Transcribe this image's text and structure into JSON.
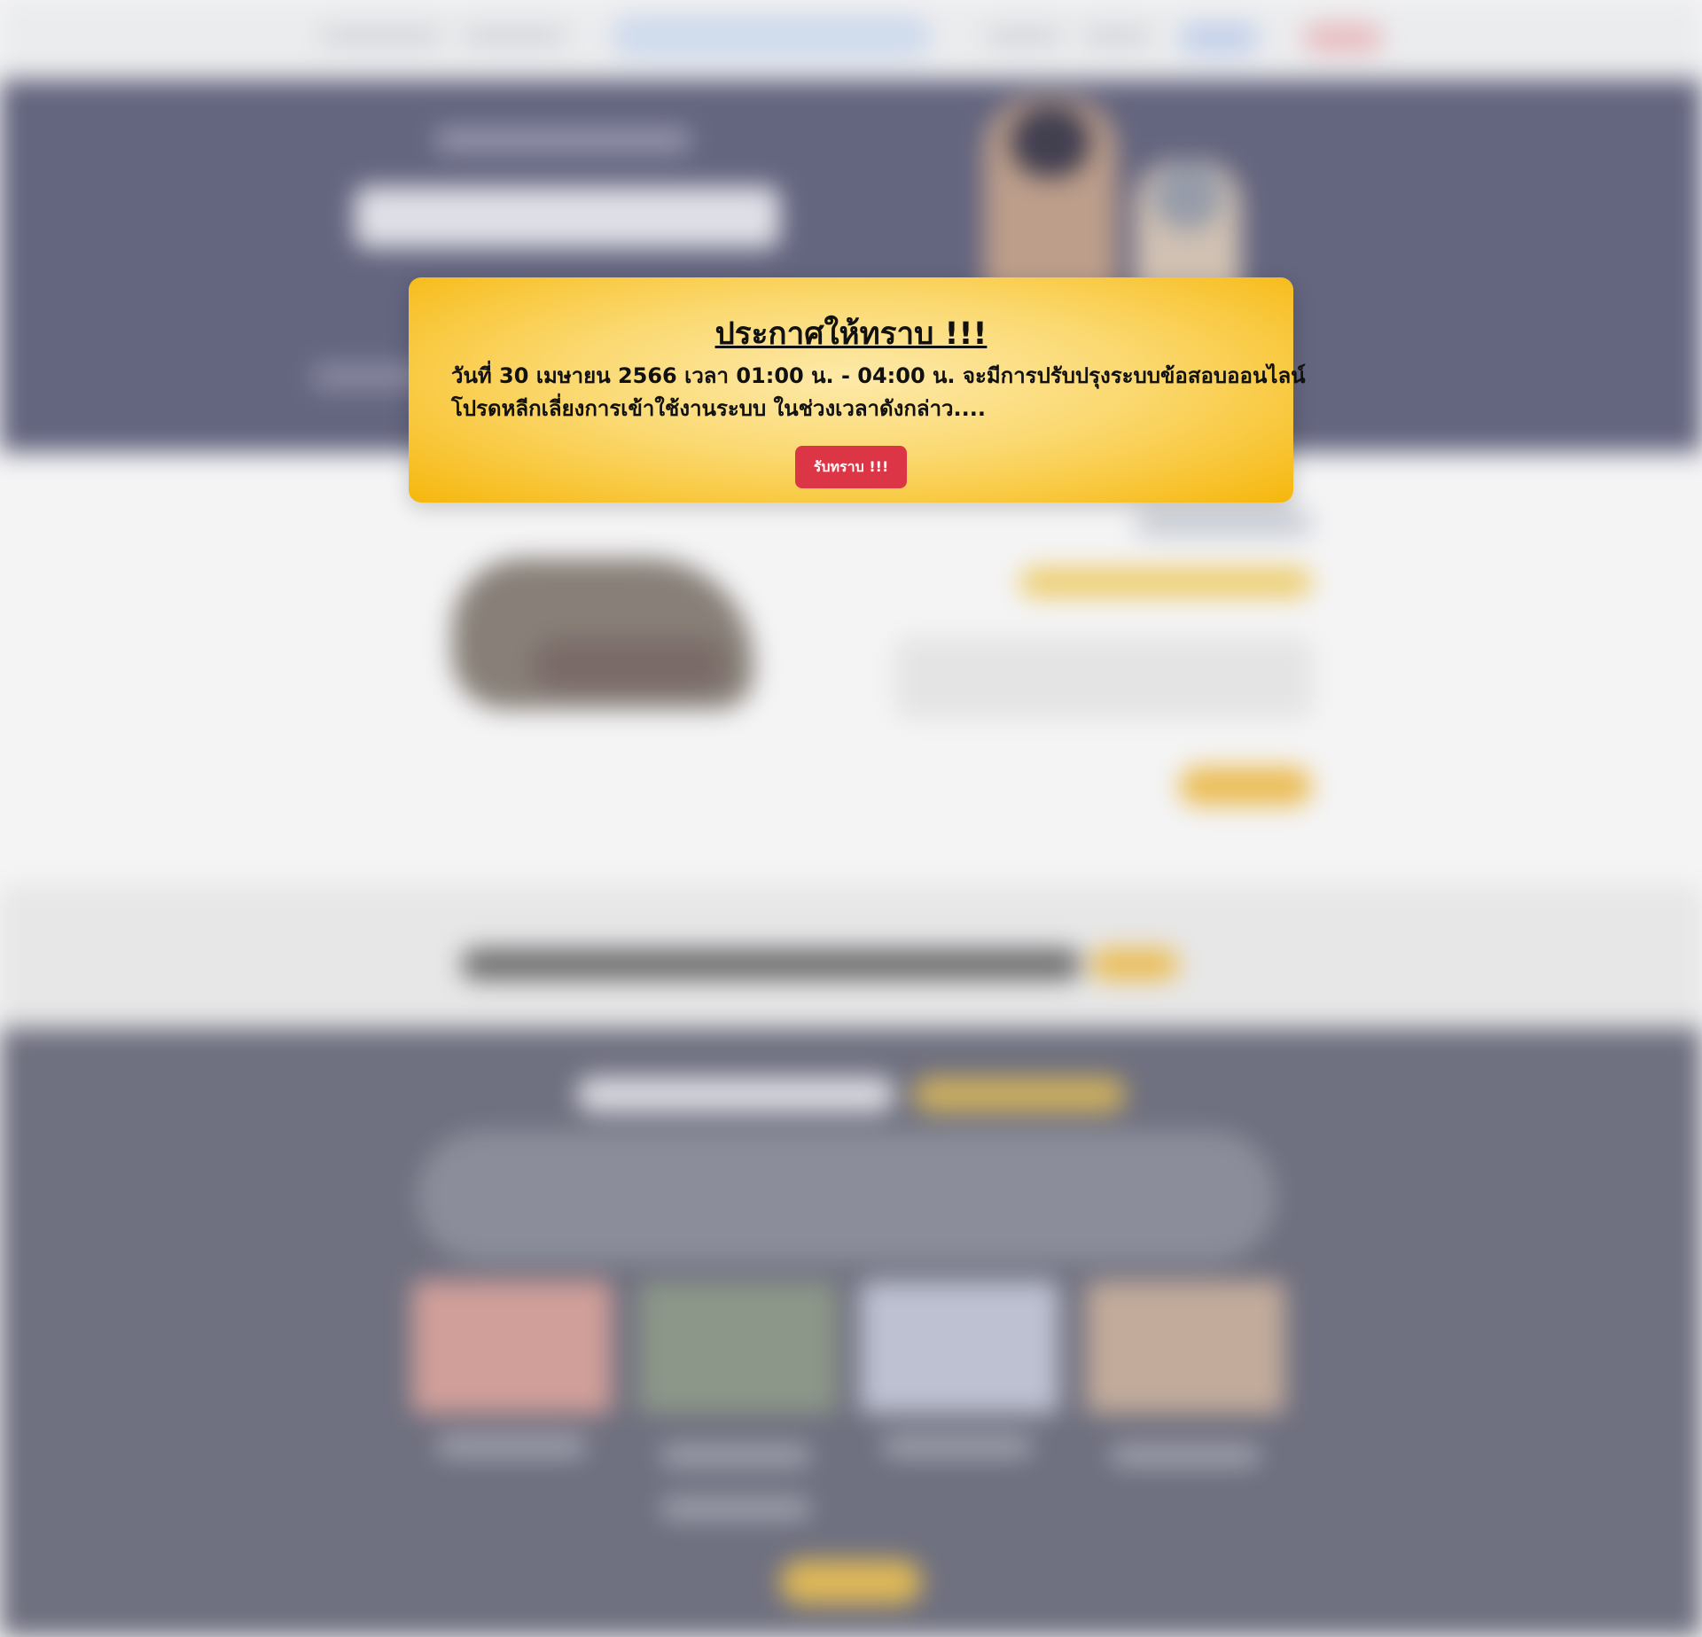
{
  "announcement": {
    "title": "ประกาศให้ทราบ !!!",
    "line1": "วันที่ 30 เมษายน 2566 เวลา 01:00 น. - 04:00 น. จะมีการปรับปรุงระบบข้อสอบออนไลน์",
    "line2": "โปรดหลีกเลี่ยงการเข้าใช้งานระบบ ในช่วงเวลาดังกล่าว....",
    "ack_label": "รับทราบ !!!"
  },
  "colors": {
    "modal_gradient_center": "#fde9a9",
    "modal_gradient_edge": "#f6b70c",
    "ack_button": "#dc3545",
    "hero_background": "#63647f"
  }
}
